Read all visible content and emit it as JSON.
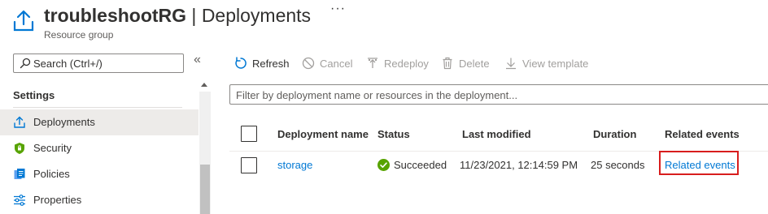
{
  "header": {
    "resource_name": "troubleshootRG",
    "separator": " | ",
    "page_name": "Deployments",
    "more_label": "···",
    "subtitle": "Resource group"
  },
  "sidebar": {
    "search_placeholder": "Search (Ctrl+/)",
    "collapse_label": "«",
    "section_title": "Settings",
    "items": [
      {
        "label": "Deployments",
        "icon": "upload-icon",
        "selected": true
      },
      {
        "label": "Security",
        "icon": "shield-icon",
        "selected": false
      },
      {
        "label": "Policies",
        "icon": "policies-icon",
        "selected": false
      },
      {
        "label": "Properties",
        "icon": "sliders-icon",
        "selected": false
      }
    ]
  },
  "toolbar": {
    "refresh_label": "Refresh",
    "cancel_label": "Cancel",
    "redeploy_label": "Redeploy",
    "delete_label": "Delete",
    "view_template_label": "View template"
  },
  "filter": {
    "placeholder": "Filter by deployment name or resources in the deployment..."
  },
  "table": {
    "columns": [
      "Deployment name",
      "Status",
      "Last modified",
      "Duration",
      "Related events"
    ],
    "rows": [
      {
        "deployment_name": "storage",
        "status": "Succeeded",
        "last_modified": "11/23/2021, 12:14:59 PM",
        "duration": "25 seconds",
        "related_events": "Related events"
      }
    ]
  },
  "colors": {
    "accent": "#0078d4",
    "success": "#57a300",
    "highlight": "#d81d1d",
    "disabled": "#a19f9d"
  }
}
